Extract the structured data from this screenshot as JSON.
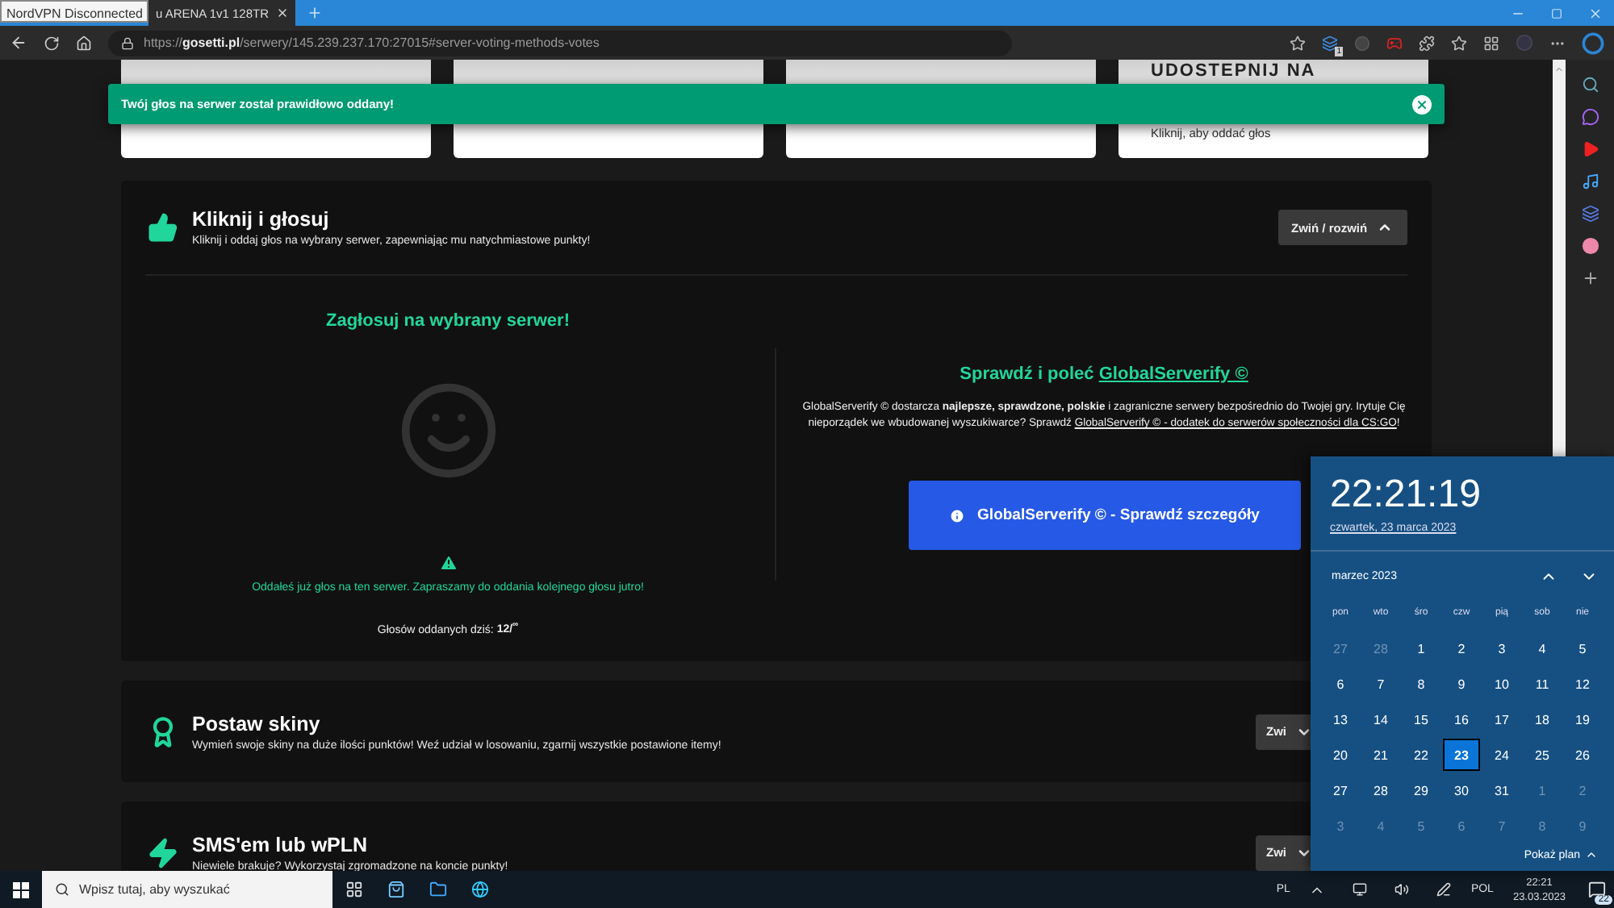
{
  "browser": {
    "tooltip": "NordVPN Disconnected",
    "tab": {
      "title": "u ARENA 1v1 128TR",
      "selected": true
    },
    "url": {
      "scheme": "https://",
      "host": "gosetti.pl",
      "path": "/serwery/145.239.237.170:27015#server-voting-methods-votes"
    },
    "extension_badge": "1"
  },
  "top_cards": [
    {
      "kind": "blank"
    },
    {
      "kind": "blank"
    },
    {
      "kind": "blank"
    },
    {
      "kind": "share",
      "title": "UDOSTEPNIJ NA",
      "subtitle": "Kliknij, aby oddać głos"
    }
  ],
  "toast": {
    "message": "Twój głos na serwer został prawidłowo oddany!"
  },
  "sections": [
    {
      "kind": "vote",
      "title": "Kliknij i głosuj",
      "subtitle": "Kliknij i oddaj głos na wybrany serwer, zapewniając mu natychmiastowe punkty!",
      "toggle": "Zwiń / rozwiń",
      "expanded": true
    },
    {
      "kind": "skins",
      "title": "Postaw skiny",
      "subtitle": "Wymień swoje skiny na duże ilości punktów! Weź udział w losowaniu, zgarnij wszystkie postawione itemy!",
      "toggle": "Zwi",
      "expanded": false
    },
    {
      "kind": "sms",
      "title": "SMS'em lub wPLN",
      "subtitle": "Niewiele brakuje? Wykorzystaj zgromadzone na koncie punkty!",
      "toggle": "Zwi",
      "expanded": false
    }
  ],
  "vote": {
    "heading": "Zagłosuj na wybrany serwer!",
    "notice": "Oddałeś już głos na ten serwer. Zapraszamy do oddania kolejnego głosu jutro!",
    "count": "Głosów oddanych dziś: **12/$^{∞}$**"
  },
  "promo": {
    "heading": "Sprawdź i poleć",
    "heading_link": "GlobalServerify ©",
    "text": "GlobalServerify © dostarcza **najlepsze, sprawdzone, polskie** i zagraniczne serwery bezpośrednio do Twojej gry. Irytuje Cię nieporządek we wbudowanej wyszukiwarce? Sprawdź",
    "link": "GlobalServerify © - dodatek do serwerów społeczności dla CS:GO",
    "text_after": "!",
    "button": "GlobalServerify © - Sprawdź szczegóły"
  },
  "calendar": {
    "time": "22:21:19",
    "date": "czwartek, 23 marca 2023",
    "month": "marzec 2023",
    "weekdays": [
      "pon",
      "wto",
      "śro",
      "czw",
      "pią",
      "sob",
      "nie"
    ],
    "weeks": [
      [
        {
          "day": "27",
          "in_month": false,
          "selected": false
        },
        {
          "day": "28",
          "in_month": false,
          "selected": false
        },
        {
          "day": "1",
          "in_month": true,
          "selected": false
        },
        {
          "day": "2",
          "in_month": true,
          "selected": false
        },
        {
          "day": "3",
          "in_month": true,
          "selected": false
        },
        {
          "day": "4",
          "in_month": true,
          "selected": false
        },
        {
          "day": "5",
          "in_month": true,
          "selected": false
        }
      ],
      [
        {
          "day": "6",
          "in_month": true,
          "selected": false
        },
        {
          "day": "7",
          "in_month": true,
          "selected": false
        },
        {
          "day": "8",
          "in_month": true,
          "selected": false
        },
        {
          "day": "9",
          "in_month": true,
          "selected": false
        },
        {
          "day": "10",
          "in_month": true,
          "selected": false
        },
        {
          "day": "11",
          "in_month": true,
          "selected": false
        },
        {
          "day": "12",
          "in_month": true,
          "selected": false
        }
      ],
      [
        {
          "day": "13",
          "in_month": true,
          "selected": false
        },
        {
          "day": "14",
          "in_month": true,
          "selected": false
        },
        {
          "day": "15",
          "in_month": true,
          "selected": false
        },
        {
          "day": "16",
          "in_month": true,
          "selected": false
        },
        {
          "day": "17",
          "in_month": true,
          "selected": false
        },
        {
          "day": "18",
          "in_month": true,
          "selected": false
        },
        {
          "day": "19",
          "in_month": true,
          "selected": false
        }
      ],
      [
        {
          "day": "20",
          "in_month": true,
          "selected": false
        },
        {
          "day": "21",
          "in_month": true,
          "selected": false
        },
        {
          "day": "22",
          "in_month": true,
          "selected": false
        },
        {
          "day": "23",
          "in_month": true,
          "selected": true
        },
        {
          "day": "24",
          "in_month": true,
          "selected": false
        },
        {
          "day": "25",
          "in_month": true,
          "selected": false
        },
        {
          "day": "26",
          "in_month": true,
          "selected": false
        }
      ],
      [
        {
          "day": "27",
          "in_month": true,
          "selected": false
        },
        {
          "day": "28",
          "in_month": true,
          "selected": false
        },
        {
          "day": "29",
          "in_month": true,
          "selected": false
        },
        {
          "day": "30",
          "in_month": true,
          "selected": false
        },
        {
          "day": "31",
          "in_month": true,
          "selected": false
        },
        {
          "day": "1",
          "in_month": false,
          "selected": false
        },
        {
          "day": "2",
          "in_month": false,
          "selected": false
        }
      ],
      [
        {
          "day": "3",
          "in_month": false,
          "selected": false
        },
        {
          "day": "4",
          "in_month": false,
          "selected": false
        },
        {
          "day": "5",
          "in_month": false,
          "selected": false
        },
        {
          "day": "6",
          "in_month": false,
          "selected": false
        },
        {
          "day": "7",
          "in_month": false,
          "selected": false
        },
        {
          "day": "8",
          "in_month": false,
          "selected": false
        },
        {
          "day": "9",
          "in_month": false,
          "selected": false
        }
      ]
    ],
    "agenda": "Pokaż plan"
  },
  "taskbar": {
    "search_placeholder": "Wpisz tutaj, aby wyszukać",
    "language": "PL",
    "input": "POL",
    "time": "22:21",
    "date": "23.03.2023",
    "notifications": "22"
  }
}
